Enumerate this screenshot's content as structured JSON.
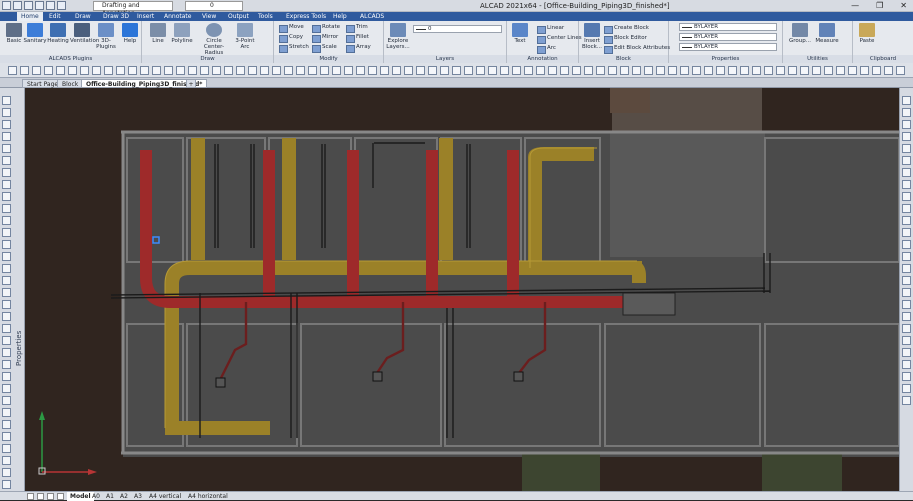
{
  "title": {
    "app": "ALCAD 2021x64 - [Office-Building_Piping3D_finished*]",
    "workspace": "Drafting and Annotation",
    "current_layer": "0"
  },
  "menu": [
    "Home",
    "Edit",
    "Draw",
    "Draw 3D",
    "Insert",
    "Annotate",
    "View",
    "Output",
    "Tools",
    "Express Tools",
    "Help",
    "ALCADS"
  ],
  "ribbon": {
    "groups": [
      {
        "label": "ALCADS Plugins",
        "buttons": [
          "Basic",
          "Sanitary",
          "Heating",
          "Ventilation",
          "3D-Plugins",
          "Help"
        ]
      },
      {
        "label": "Draw",
        "buttons": [
          "Line",
          "Polyline",
          "Circle Center-Radius",
          "3-Point Arc"
        ]
      },
      {
        "label": "Modify",
        "buttons": [
          "Move",
          "Rotate",
          "Trim",
          "Copy",
          "Mirror",
          "Fillet",
          "Stretch",
          "Scale",
          "Array"
        ]
      },
      {
        "label": "Layers",
        "buttons": [
          "Explore Layers..."
        ],
        "layer_value": "0"
      },
      {
        "label": "Annotation",
        "buttons": [
          "Text",
          "Linear",
          "Center Lines",
          "Arc"
        ]
      },
      {
        "label": "Block",
        "buttons": [
          "Insert Block...",
          "Create Block",
          "Block Editor",
          "Edit Block Attributes"
        ]
      },
      {
        "label": "Properties",
        "values": [
          "BYLAYER",
          "BYLAYER",
          "BYLAYER"
        ]
      },
      {
        "label": "Utilities",
        "buttons": [
          "Group...",
          "Measure"
        ]
      },
      {
        "label": "Clipboard",
        "buttons": [
          "Paste"
        ]
      }
    ]
  },
  "document_tabs": [
    "Start Page",
    "Block",
    "Office-Building_Piping3D_finished*"
  ],
  "side_panel": "Properties",
  "layout_tabs": [
    "Model",
    "A0",
    "A1",
    "A2",
    "A3",
    "A4 vertical",
    "A4 horizontal"
  ],
  "colors": {
    "background": "#30251f",
    "pipe_red": "#9e2a2a",
    "pipe_yellow": "#9b8128",
    "room_gray": "#4d4d4d",
    "wall": "#777777",
    "accent": "#2f5a9e"
  },
  "icons": [
    "app-menu-icon",
    "new-icon",
    "open-icon",
    "save-icon",
    "undo-icon",
    "redo-icon",
    "gear-icon",
    "axis-icon",
    "close-icon"
  ]
}
